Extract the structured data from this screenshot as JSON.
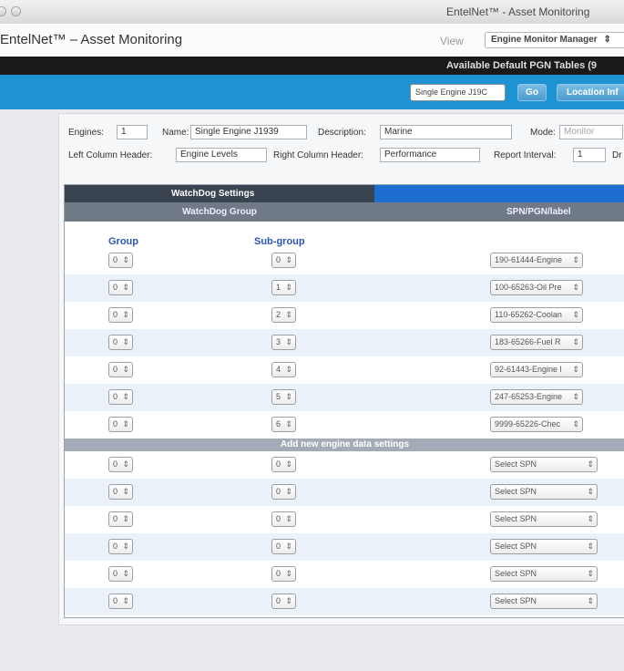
{
  "window": {
    "title": "EntelNet™ - Asset Monitoring"
  },
  "app": {
    "title": "EntelNet™ – Asset Monitoring",
    "view_label": "View",
    "view_value": "Engine Monitor Manager"
  },
  "pgn_bar": {
    "title": "Available Default PGN Tables (9"
  },
  "toolbar": {
    "engine_select": "Single Engine J19C",
    "go_label": "Go",
    "location_label": "Location Inf"
  },
  "form": {
    "engines_label": "Engines:",
    "engines_value": "1",
    "name_label": "Name:",
    "name_value": "Single Engine J1939",
    "description_label": "Description:",
    "description_value": "Marine",
    "mode_label": "Mode:",
    "mode_value": "Monitor",
    "left_header_label": "Left Column Header:",
    "left_header_value": "Engine Levels",
    "right_header_label": "Right Column Header:",
    "right_header_value": "Performance",
    "report_interval_label": "Report Interval:",
    "report_interval_value": "1",
    "truncated_label": "Dr"
  },
  "watchdog": {
    "section_title": "WatchDog Settings",
    "col_group_header": "WatchDog Group",
    "col_spn_header": "SPN/PGN/label",
    "group_label": "Group",
    "subgroup_label": "Sub-group",
    "rows": [
      {
        "group": "0",
        "subgroup": "0",
        "spn": "190-61444-Engine"
      },
      {
        "group": "0",
        "subgroup": "1",
        "spn": "100-65263-Oil Pre"
      },
      {
        "group": "0",
        "subgroup": "2",
        "spn": "110-65262-Coolan"
      },
      {
        "group": "0",
        "subgroup": "3",
        "spn": "183-65266-Fuel R"
      },
      {
        "group": "0",
        "subgroup": "4",
        "spn": "92-61443-Engine l"
      },
      {
        "group": "0",
        "subgroup": "5",
        "spn": "247-65253-Engine"
      },
      {
        "group": "0",
        "subgroup": "6",
        "spn": "9999-65226-Chec"
      }
    ],
    "add_section_title": "Add new engine data settings",
    "new_rows": [
      {
        "group": "0",
        "subgroup": "0",
        "spn": "Select SPN"
      },
      {
        "group": "0",
        "subgroup": "0",
        "spn": "Select SPN"
      },
      {
        "group": "0",
        "subgroup": "0",
        "spn": "Select SPN"
      },
      {
        "group": "0",
        "subgroup": "0",
        "spn": "Select SPN"
      },
      {
        "group": "0",
        "subgroup": "0",
        "spn": "Select SPN"
      },
      {
        "group": "0",
        "subgroup": "0",
        "spn": "Select SPN"
      }
    ]
  }
}
